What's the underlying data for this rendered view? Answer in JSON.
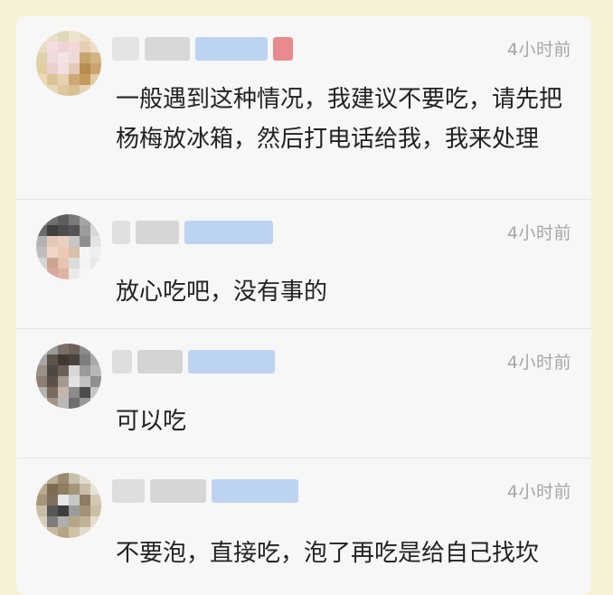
{
  "comments": [
    {
      "time": "4小时前",
      "text": "一般遇到这种情况，我建议不要吃，请先把杨梅放冰箱，然后打电话给我，我来处理"
    },
    {
      "time": "4小时前",
      "text": "放心吃吧，没有事的"
    },
    {
      "time": "4小时前",
      "text": "可以吃"
    },
    {
      "time": "4小时前",
      "text": "不要泡，直接吃，泡了再吃是给自己找坎"
    }
  ],
  "colors": {
    "page_background": "#f7f2d6",
    "card_background": "#f7f7f7",
    "timestamp": "#a6a6a6",
    "comment_text": "#222222",
    "blurred_name_gray": "#dcdcdc",
    "blurred_name_blue": "#b9d3f2",
    "blurred_name_red": "#e98a8f"
  }
}
